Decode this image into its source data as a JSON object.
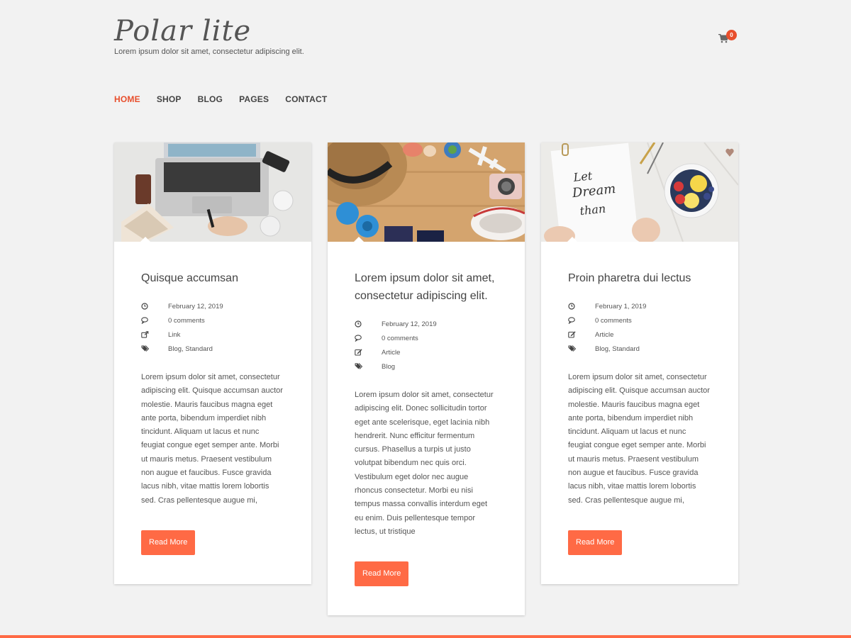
{
  "site": {
    "title": "Polar lite",
    "tagline": "Lorem ipsum dolor sit amet, consectetur adipiscing elit.",
    "cart_count": "0"
  },
  "nav": [
    {
      "label": "HOME",
      "active": true
    },
    {
      "label": "SHOP",
      "active": false
    },
    {
      "label": "BLOG",
      "active": false
    },
    {
      "label": "PAGES",
      "active": false
    },
    {
      "label": "CONTACT",
      "active": false
    }
  ],
  "posts": [
    {
      "title": "Quisque accumsan",
      "date": "February 12, 2019",
      "comments": "0 comments",
      "format": "Link",
      "tags": "Blog, Standard",
      "excerpt": "Lorem ipsum dolor sit amet, consectetur adipiscing elit. Quisque accumsan auctor molestie. Mauris faucibus magna eget ante porta, bibendum imperdiet nibh tincidunt. Aliquam ut lacus et nunc feugiat congue eget semper ante. Morbi ut mauris metus. Praesent vestibulum non augue et faucibus. Fusce gravida lacus nibh, vitae mattis lorem lobortis sed. Cras pellentesque augue mi,",
      "button": "Read More"
    },
    {
      "title": "Lorem ipsum dolor sit amet, consectetur adipiscing elit.",
      "date": "February 12, 2019",
      "comments": "0 comments",
      "format": "Article",
      "tags": "Blog",
      "excerpt": "Lorem ipsum dolor sit amet, consectetur adipiscing elit. Donec sollicitudin tortor eget ante scelerisque, eget lacinia nibh hendrerit. Nunc efficitur fermentum cursus. Phasellus a turpis ut justo volutpat bibendum nec quis orci. Vestibulum eget dolor nec augue rhoncus consectetur. Morbi eu nisi tempus massa convallis interdum eget eu enim. Duis pellentesque tempor lectus, ut tristique",
      "button": "Read More"
    },
    {
      "title": "Proin pharetra dui lectus",
      "date": "February 1, 2019",
      "comments": "0 comments",
      "format": "Article",
      "tags": "Blog, Standard",
      "excerpt": "Lorem ipsum dolor sit amet, consectetur adipiscing elit. Quisque accumsan auctor molestie. Mauris faucibus magna eget ante porta, bibendum imperdiet nibh tincidunt. Aliquam ut lacus et nunc feugiat congue eget semper ante. Morbi ut mauris metus. Praesent vestibulum non augue et faucibus. Fusce gravida lacus nibh, vitae mattis lorem lobortis sed. Cras pellentesque augue mi,",
      "button": "Read More"
    }
  ],
  "icons": {
    "date": "clock-icon",
    "comments": "comments-icon",
    "format": "external-link-icon",
    "format_article": "edit-icon",
    "tags": "tags-icon",
    "cart": "shopping-cart-icon"
  },
  "colors": {
    "accent": "#ff6a45",
    "nav_active": "#e84e2c",
    "background": "#f2f2f2"
  }
}
